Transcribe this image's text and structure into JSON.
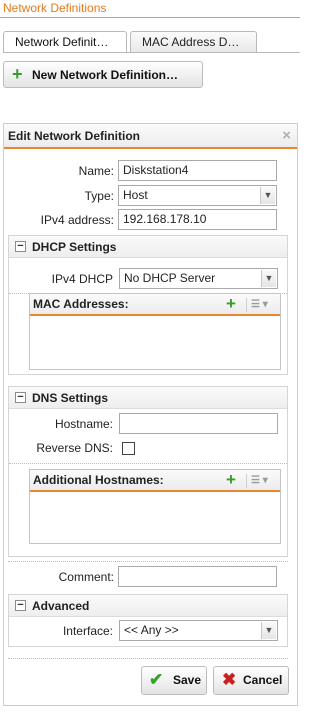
{
  "panel_title": "Network Definitions",
  "tabs": [
    {
      "label": "Network Definit…"
    },
    {
      "label": "MAC Address D…"
    }
  ],
  "new_button": {
    "label": "New Network Definition…",
    "icon": "plus-icon"
  },
  "dialog": {
    "title": "Edit Network Definition",
    "close_icon": "×",
    "name": {
      "label": "Name:",
      "value": "Diskstation4"
    },
    "type": {
      "label": "Type:",
      "value": "Host"
    },
    "ipv4": {
      "label": "IPv4 address:",
      "value": "192.168.178.10"
    },
    "dhcp": {
      "title": "DHCP Settings",
      "ipv4_dhcp": {
        "label": "IPv4 DHCP",
        "value": "No DHCP Server"
      },
      "mac_list": {
        "title": "MAC Addresses:"
      }
    },
    "dns": {
      "title": "DNS Settings",
      "hostname": {
        "label": "Hostname:",
        "value": ""
      },
      "reverse_dns": {
        "label": "Reverse DNS:",
        "checked": false
      },
      "additional": {
        "title": "Additional Hostnames:"
      }
    },
    "comment": {
      "label": "Comment:",
      "value": ""
    },
    "advanced": {
      "title": "Advanced",
      "interface": {
        "label": "Interface:",
        "value": "<< Any >>"
      }
    },
    "save_label": "Save",
    "cancel_label": "Cancel"
  },
  "colors": {
    "accent": "#e9862d",
    "title": "#e57a1e",
    "save_check": "#3b9b2f",
    "cancel_x": "#c8201f"
  }
}
